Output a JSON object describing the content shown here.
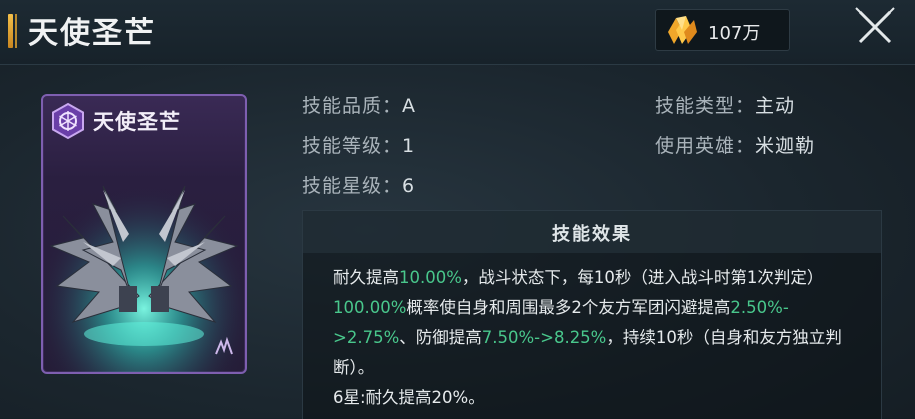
{
  "header": {
    "title": "天使圣芒",
    "currency_value": "107万",
    "currency_icon": "crystal-icon",
    "close_icon": "close-icon"
  },
  "card": {
    "title": "天使圣芒",
    "emblem_icon": "hexagon-emblem-icon",
    "art": "mechanical-wings-art",
    "frame_color": "#7e5fb0"
  },
  "info": {
    "quality_label": "技能品质：",
    "quality_value": "A",
    "level_label": "技能等级：",
    "level_value": "1",
    "star_label": "技能星级：",
    "star_value": "6",
    "type_label": "技能类型：",
    "type_value": "主动",
    "hero_label": "使用英雄：",
    "hero_value": "米迦勒"
  },
  "effect": {
    "title": "技能效果",
    "highlight_color": "#49c78c",
    "segments": {
      "s1": "耐久提高",
      "h1": "10.00%",
      "s2": "，战斗状态下，每10秒（进入战斗时第1次判定）",
      "h2": "100.00%",
      "s3": "概率使自身和周围最多2个友方军团闪避提高",
      "h3": "2.50%->2.75%",
      "s4": "、防御提高",
      "h4": "7.50%->8.25%",
      "s5": "，持续10秒（自身和友方独立判断）。",
      "line2": "6星:耐久提高20%。"
    }
  }
}
